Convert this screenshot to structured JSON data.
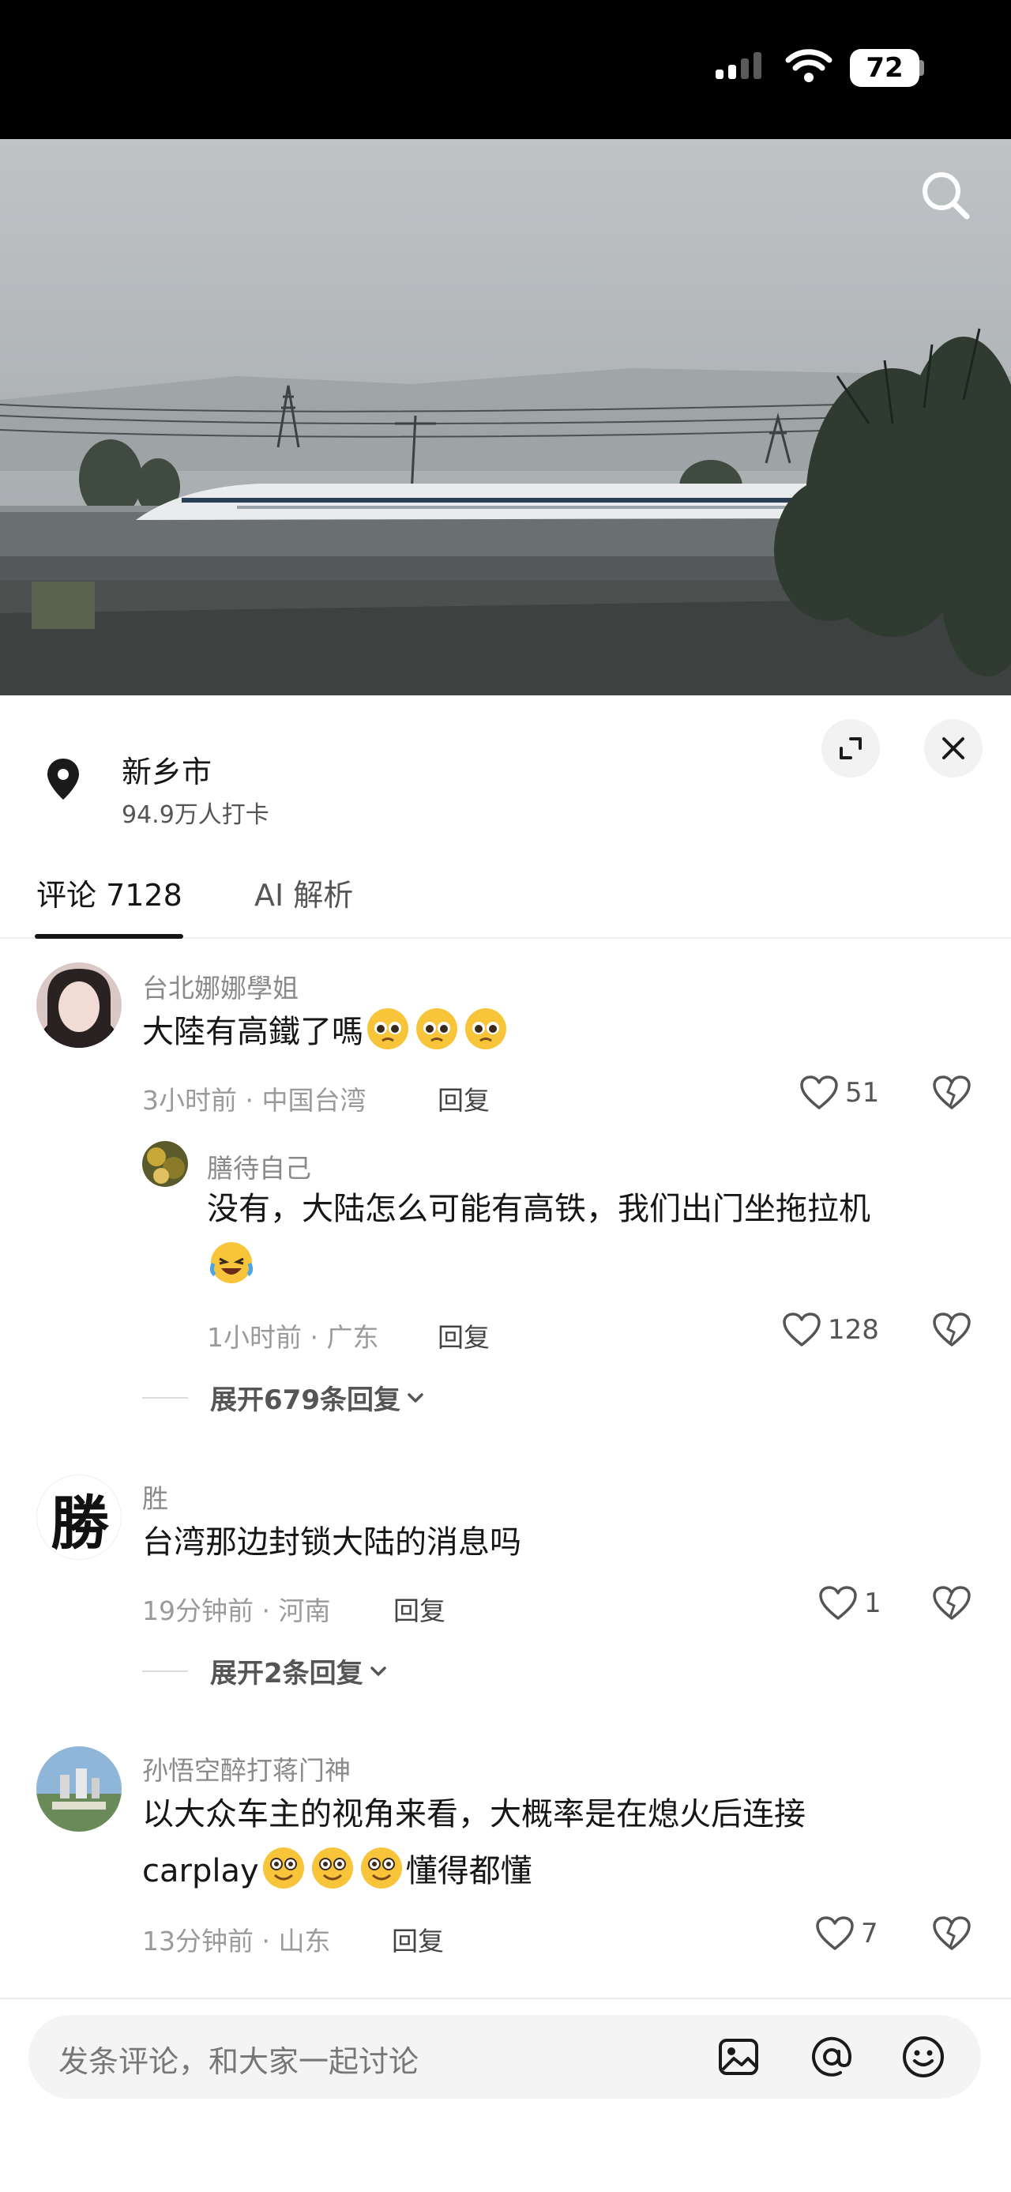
{
  "status_bar": {
    "battery": "72",
    "signal_icon": "cellular-signal-icon",
    "wifi_icon": "wifi-icon"
  },
  "video": {
    "search_icon": "search-icon"
  },
  "location": {
    "name": "新乡市",
    "checkins": "94.9万人打卡",
    "icon": "location-pin-icon"
  },
  "tabs": [
    {
      "label": "评论 7128",
      "active": true
    },
    {
      "label": "AI 解析",
      "active": false
    }
  ],
  "comments": [
    {
      "user": "台北娜娜學姐",
      "text": "大陸有高鐵了嗎",
      "emoji": [
        "pleading-face-emoji",
        "pleading-face-emoji",
        "pleading-face-emoji"
      ],
      "meta": "3小时前 · 中国台湾",
      "reply_label": "回复",
      "likes": "51",
      "replies": [
        {
          "user": "膳待自己",
          "text": "没有，大陆怎么可能有高铁，我们出门坐拖拉机",
          "emoji": [
            "laughing-crying-emoji"
          ],
          "meta": "1小时前 · 广东",
          "reply_label": "回复",
          "likes": "128"
        }
      ],
      "expand_label": "展开679条回复"
    },
    {
      "user": "胜",
      "text": "台湾那边封锁大陆的消息吗",
      "meta": "19分钟前 · 河南",
      "reply_label": "回复",
      "likes": "1",
      "expand_label": "展开2条回复",
      "avatar_char": "勝"
    },
    {
      "user": "孙悟空醉打蒋门神",
      "text_part1": "以大众车主的视角来看，大概率是在熄火后连接",
      "text_part2a": "carplay",
      "text_part2b": "懂得都懂",
      "emoji": [
        "flushed-smile-emoji",
        "flushed-smile-emoji",
        "flushed-smile-emoji"
      ],
      "meta": "13分钟前 · 山东",
      "reply_label": "回复",
      "likes": "7"
    }
  ],
  "input": {
    "placeholder": "发条评论，和大家一起讨论",
    "icons": [
      "image-icon",
      "mention-icon",
      "emoji-icon"
    ]
  },
  "colors": {
    "status_bar_bg": "#000000",
    "sheet_bg": "#ffffff",
    "text_primary": "#161616",
    "text_secondary": "#8a8a8a"
  }
}
